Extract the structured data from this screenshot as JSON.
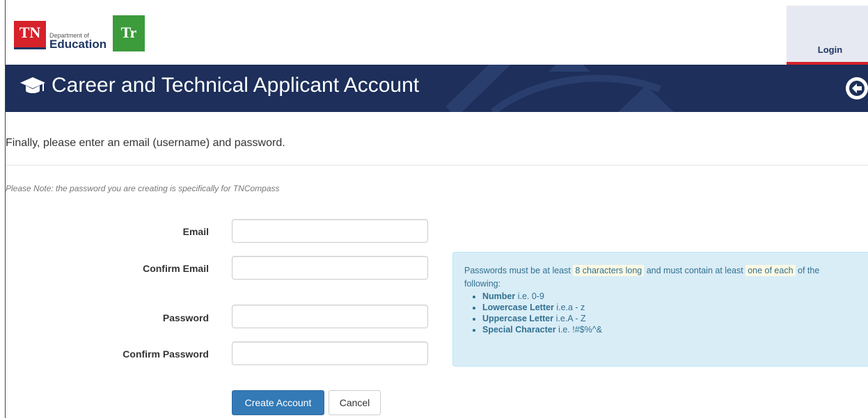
{
  "header": {
    "tn_logo_text": "TN",
    "dept_line1": "Department of",
    "dept_line2": "Education",
    "tr_logo_text": "Tr",
    "login_label": "Login"
  },
  "banner": {
    "title": "Career and Technical Applicant Account",
    "icon": "graduation-cap-icon",
    "back_icon": "circle-arrow-left-icon"
  },
  "form": {
    "instruction": "Finally, please enter an email (username) and password.",
    "note": "Please Note: the password you are creating is specifically for TNCompass",
    "email_label": "Email",
    "confirm_email_label": "Confirm Email",
    "password_label": "Password",
    "confirm_password_label": "Confirm Password",
    "email_value": "",
    "confirm_email_value": "",
    "password_value": "",
    "confirm_password_value": "",
    "create_button": "Create Account",
    "cancel_button": "Cancel"
  },
  "password_rules": {
    "intro_1": "Passwords must be at least",
    "highlight_1": "8 characters long",
    "intro_2": "and must contain at least",
    "highlight_2": "one of each",
    "intro_3": "of the following:",
    "items": [
      {
        "name": "Number",
        "example": "i.e. 0-9"
      },
      {
        "name": "Lowercase Letter",
        "example": "i.e.a - z"
      },
      {
        "name": "Uppercase Letter",
        "example": "i.e.A - Z"
      },
      {
        "name": "Special Character",
        "example": "i.e. !#$%^&"
      }
    ]
  },
  "colors": {
    "banner": "#1d2f5a",
    "accent_red": "#d5222b",
    "primary_button": "#337ab7",
    "info_bg": "#d9edf7"
  }
}
